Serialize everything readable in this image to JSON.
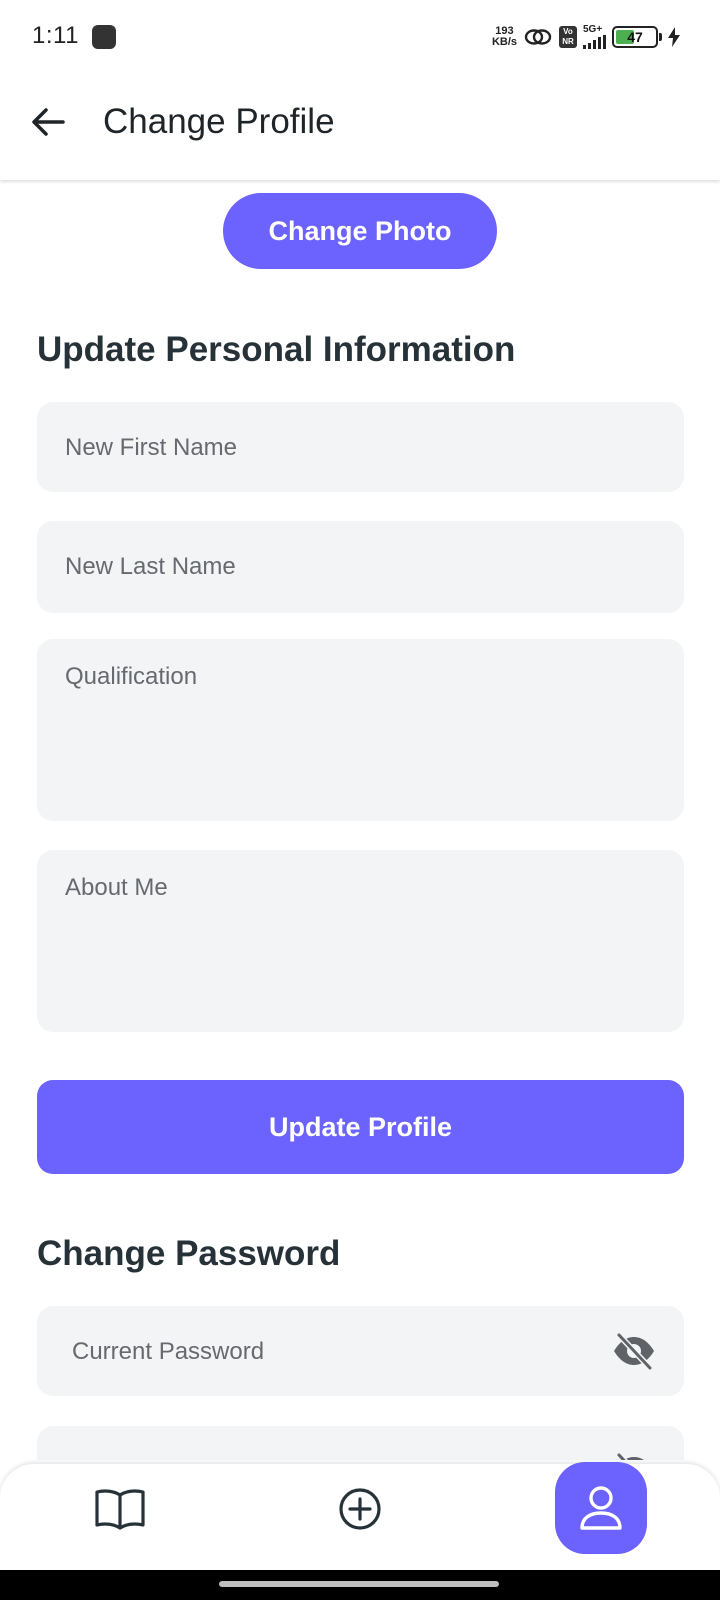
{
  "status_bar": {
    "time": "1:11",
    "speed_value": "193",
    "speed_unit": "KB/s",
    "volte_top": "Vo",
    "volte_bottom": "NR",
    "network": "5G+",
    "battery": "47"
  },
  "app_bar": {
    "title": "Change Profile",
    "back_icon": "arrow-left-icon"
  },
  "photo": {
    "button_label": "Change Photo"
  },
  "personal_info": {
    "heading": "Update Personal Information",
    "first_name_placeholder": "New First Name",
    "last_name_placeholder": "New Last Name",
    "qualification_placeholder": "Qualification",
    "about_placeholder": "About Me",
    "submit_label": "Update Profile"
  },
  "password": {
    "heading": "Change Password",
    "current_placeholder": "Current Password",
    "visibility_icon": "eye-off-icon"
  },
  "bottom_nav": {
    "items": [
      {
        "icon": "book-icon",
        "active": false
      },
      {
        "icon": "plus-circle-icon",
        "active": false
      },
      {
        "icon": "user-icon",
        "active": true
      }
    ]
  },
  "colors": {
    "accent": "#6c63ff",
    "field_background": "#f3f4f6",
    "heading_text": "#263238",
    "placeholder_text": "#666a70"
  }
}
